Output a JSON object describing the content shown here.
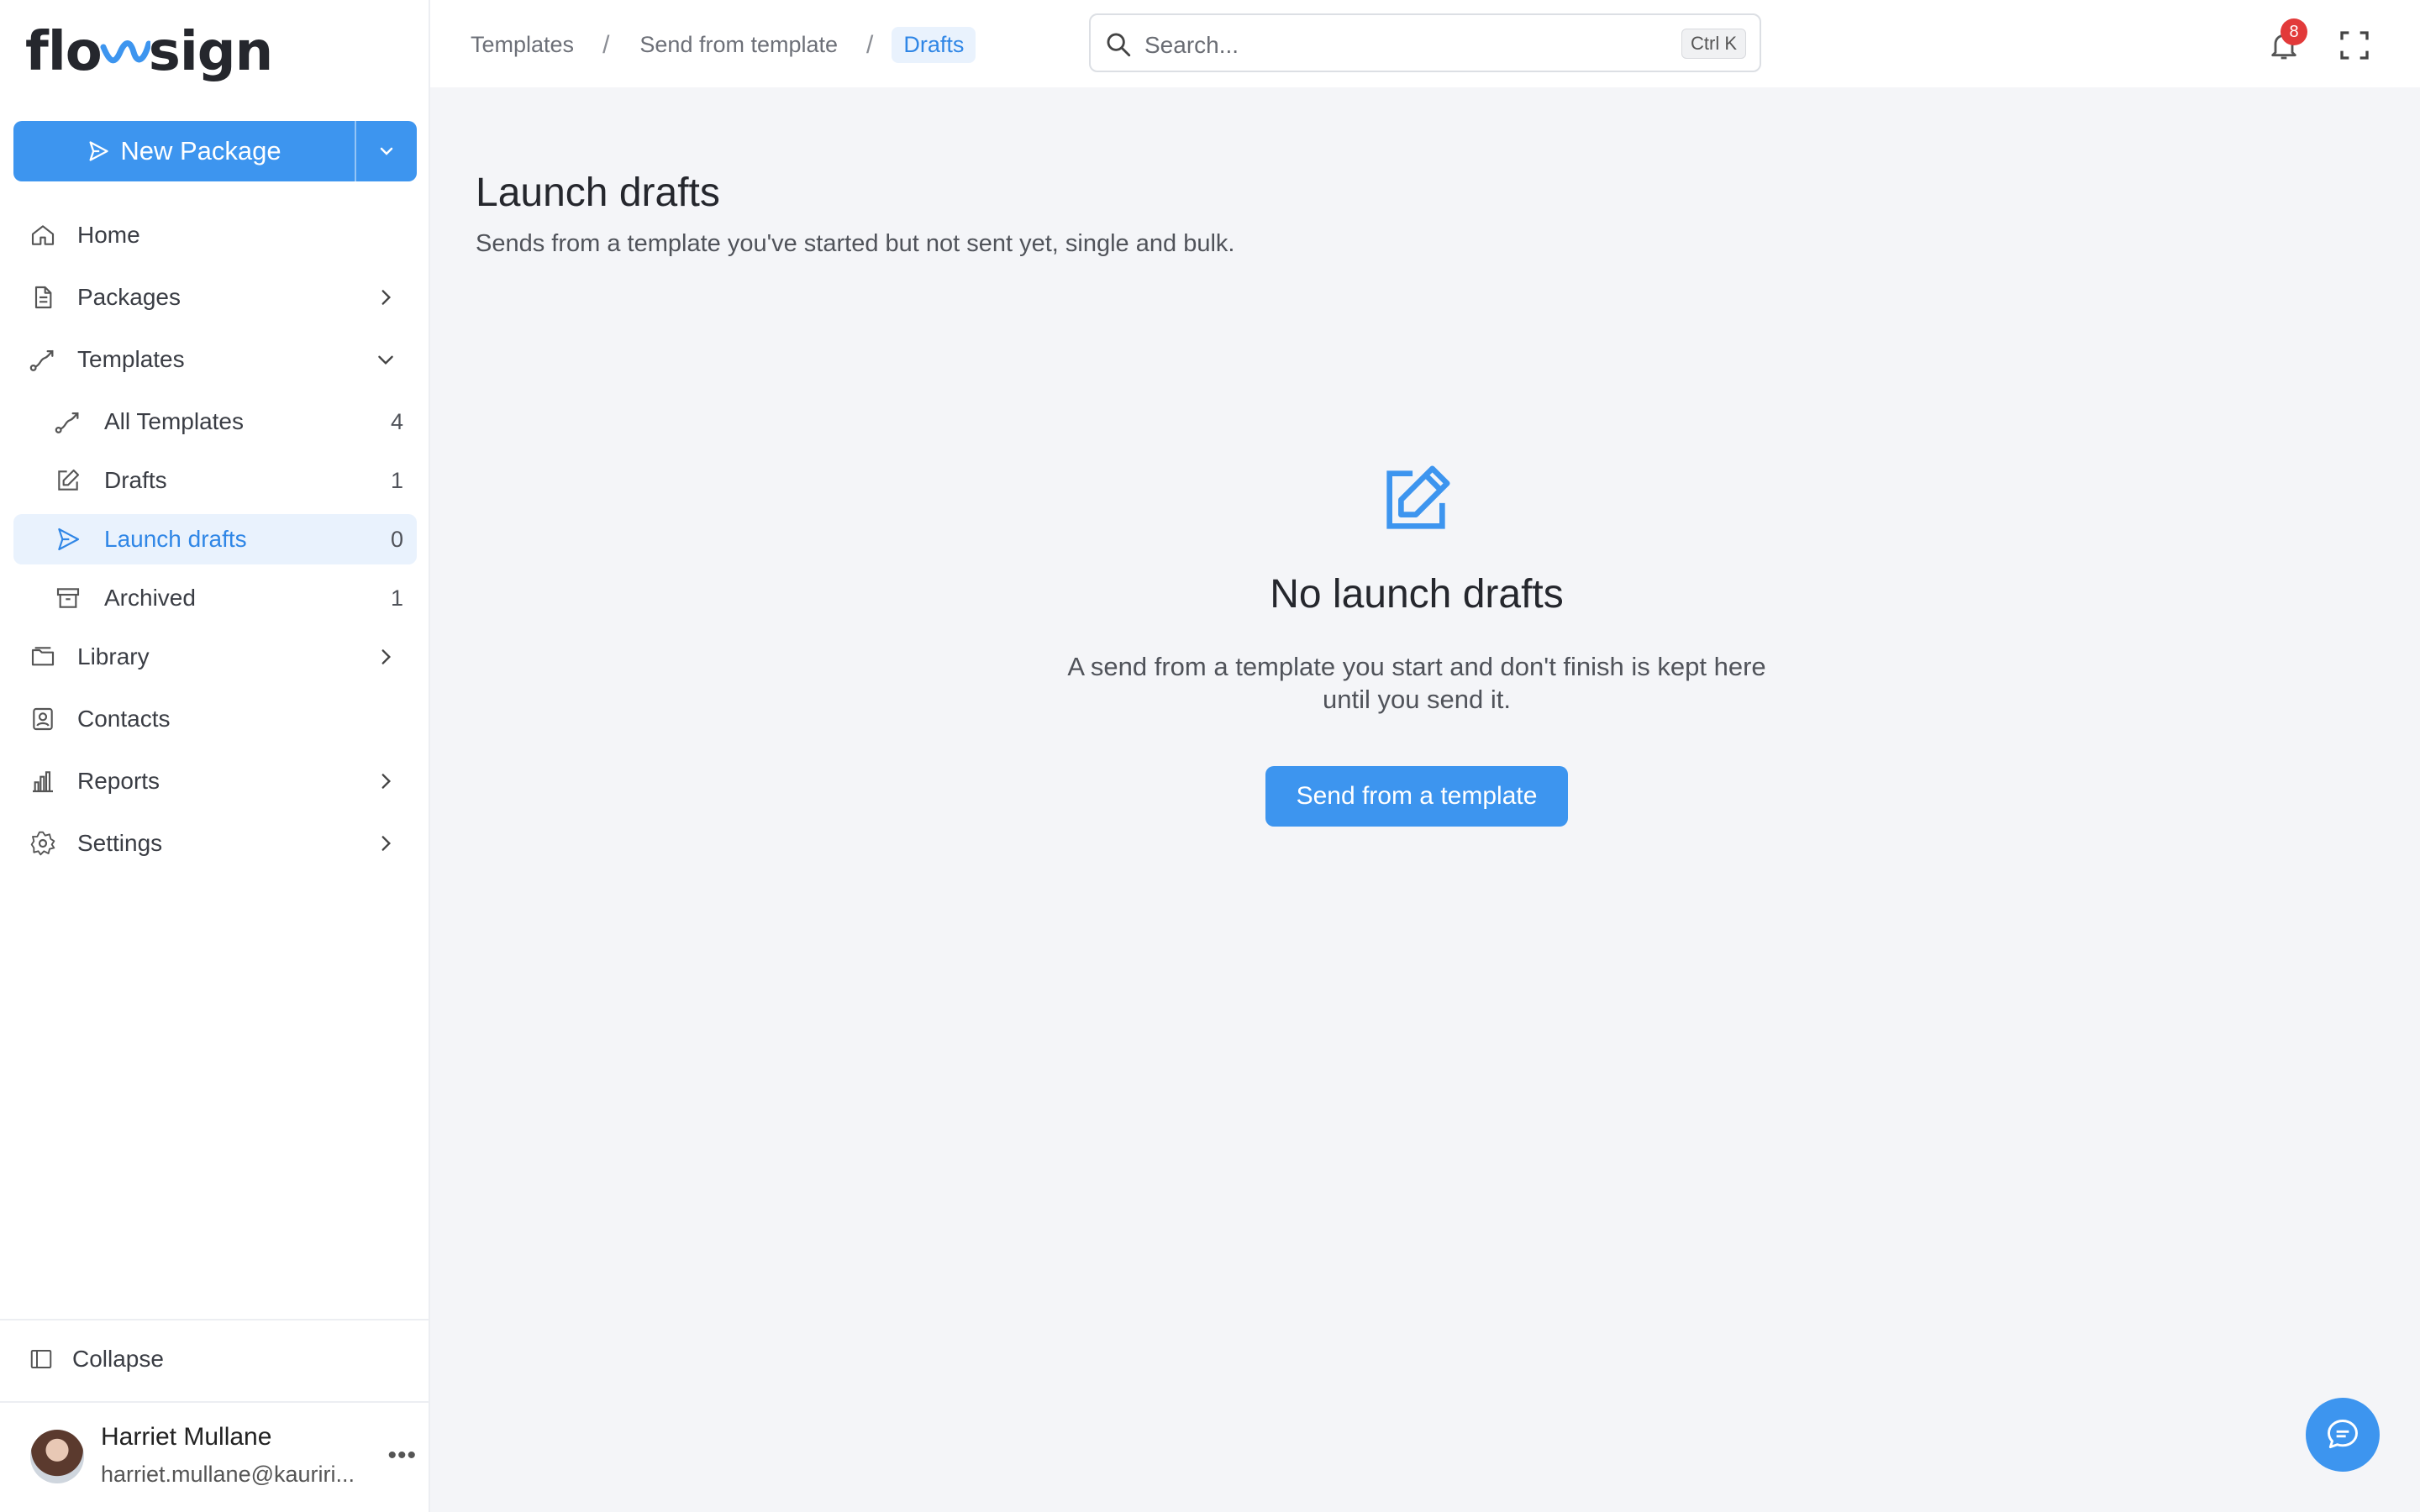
{
  "brand": {
    "name_left": "flo",
    "name_right": "sign"
  },
  "colors": {
    "accent": "#3d95ef",
    "active_bg": "#e9f2fd",
    "badge": "#e23a3a"
  },
  "sidebar": {
    "new_package_label": "New Package",
    "items": [
      {
        "label": "Home",
        "icon": "home-icon"
      },
      {
        "label": "Packages",
        "icon": "document-icon"
      },
      {
        "label": "Templates",
        "icon": "route-icon"
      },
      {
        "label": "Library",
        "icon": "folder-icon"
      },
      {
        "label": "Contacts",
        "icon": "contact-icon"
      },
      {
        "label": "Reports",
        "icon": "bar-chart-icon"
      },
      {
        "label": "Settings",
        "icon": "gear-icon"
      }
    ],
    "templates_sub": [
      {
        "label": "All Templates",
        "count": "4",
        "icon": "route-icon"
      },
      {
        "label": "Drafts",
        "count": "1",
        "icon": "edit-icon"
      },
      {
        "label": "Launch drafts",
        "count": "0",
        "icon": "send-icon",
        "active": true
      },
      {
        "label": "Archived",
        "count": "1",
        "icon": "archive-icon"
      }
    ],
    "collapse_label": "Collapse",
    "user": {
      "name": "Harriet Mullane",
      "email": "harriet.mullane@kauriri...",
      "more": "•••"
    }
  },
  "header": {
    "breadcrumbs": [
      "Templates",
      "Send from template",
      "Drafts"
    ],
    "separator": "/",
    "search_placeholder": "Search...",
    "search_shortcut": "Ctrl K",
    "notification_count": "8"
  },
  "main": {
    "title": "Launch drafts",
    "subtitle": "Sends from a template you've started but not sent yet, single and bulk.",
    "empty_title": "No launch drafts",
    "empty_desc": "A send from a template you start and don't finish is kept here until you send it.",
    "cta_label": "Send from a template"
  }
}
